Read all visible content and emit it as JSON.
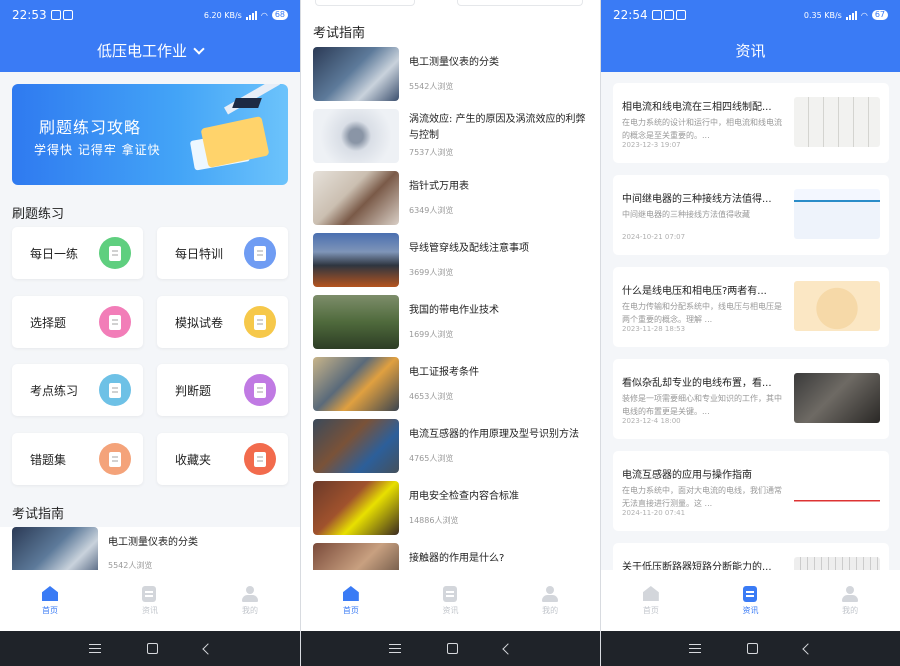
{
  "colors": {
    "primary": "#3a7bf5"
  },
  "screen1": {
    "status": {
      "time": "22:53",
      "net": "6.20 KB/s",
      "battery": "68"
    },
    "header": {
      "title": "低压电工作业"
    },
    "banner": {
      "title": "刷题练习攻略",
      "subtitle": "学得快 记得牢 拿证快"
    },
    "practice_title": "刷题练习",
    "practice": [
      {
        "label": "每日一练",
        "icon": "notebook-icon"
      },
      {
        "label": "每日特训",
        "icon": "edit-icon"
      },
      {
        "label": "选择题",
        "icon": "list-icon"
      },
      {
        "label": "模拟试卷",
        "icon": "paper-icon"
      },
      {
        "label": "考点练习",
        "icon": "pen-doc-icon"
      },
      {
        "label": "判断题",
        "icon": "doc-icon"
      },
      {
        "label": "错题集",
        "icon": "book-icon"
      },
      {
        "label": "收藏夹",
        "icon": "folder-star-icon"
      }
    ],
    "guide_title": "考试指南",
    "guide_first": {
      "title": "电工测量仪表的分类",
      "views": "5542人浏览"
    }
  },
  "screen2": {
    "guide_title": "考试指南",
    "items": [
      {
        "title": "电工测量仪表的分类",
        "views": "5542人浏览"
      },
      {
        "title": "涡流效应: 产生的原因及涡流效应的利弊与控制",
        "views": "7537人浏览"
      },
      {
        "title": "指针式万用表",
        "views": "6349人浏览"
      },
      {
        "title": "导线管穿线及配线注意事项",
        "views": "3699人浏览"
      },
      {
        "title": "我国的带电作业技术",
        "views": "1699人浏览"
      },
      {
        "title": "电工证报考条件",
        "views": "4653人浏览"
      },
      {
        "title": "电流互感器的作用原理及型号识别方法",
        "views": "4765人浏览"
      },
      {
        "title": "用电安全检查内容合标准",
        "views": "14886人浏览"
      },
      {
        "title": "接触器的作用是什么?",
        "views": ""
      }
    ]
  },
  "screen3": {
    "status": {
      "time": "22:54",
      "net": "0.35 KB/s",
      "battery": "67"
    },
    "header": {
      "title": "资讯"
    },
    "news": [
      {
        "title": "相电流和线电流在三相四线制配...",
        "desc": "在电力系统的设计和运行中，相电流和线电流的概念是至关重要的。...",
        "date": "2023-12-3 19:07"
      },
      {
        "title": "中间继电器的三种接线方法值得...",
        "desc": "中间继电器的三种接线方法值得收藏",
        "date": "2024-10-21 07:07"
      },
      {
        "title": "什么是线电压和相电压?两者有...",
        "desc": "在电力传输和分配系统中，线电压与相电压是两个重要的概念。理解 ...",
        "date": "2023-11-28 18:53"
      },
      {
        "title": "看似杂乱却专业的电线布置，看...",
        "desc": "装修是一项需要细心和专业知识的工作，其中电线的布置更是关键。...",
        "date": "2023-12-4 18:00"
      },
      {
        "title": "电流互感器的应用与操作指南",
        "desc": "在电力系统中，面对大电流的电线，我们通常无法直接进行测量。这 ...",
        "date": "2024-11-20 07:41"
      },
      {
        "title": "关于低压断路器短路分断能力的...",
        "desc": "",
        "date": ""
      }
    ]
  },
  "tabs": [
    {
      "label": "首页",
      "icon": "home-icon"
    },
    {
      "label": "资讯",
      "icon": "news-icon"
    },
    {
      "label": "我的",
      "icon": "user-icon"
    }
  ]
}
